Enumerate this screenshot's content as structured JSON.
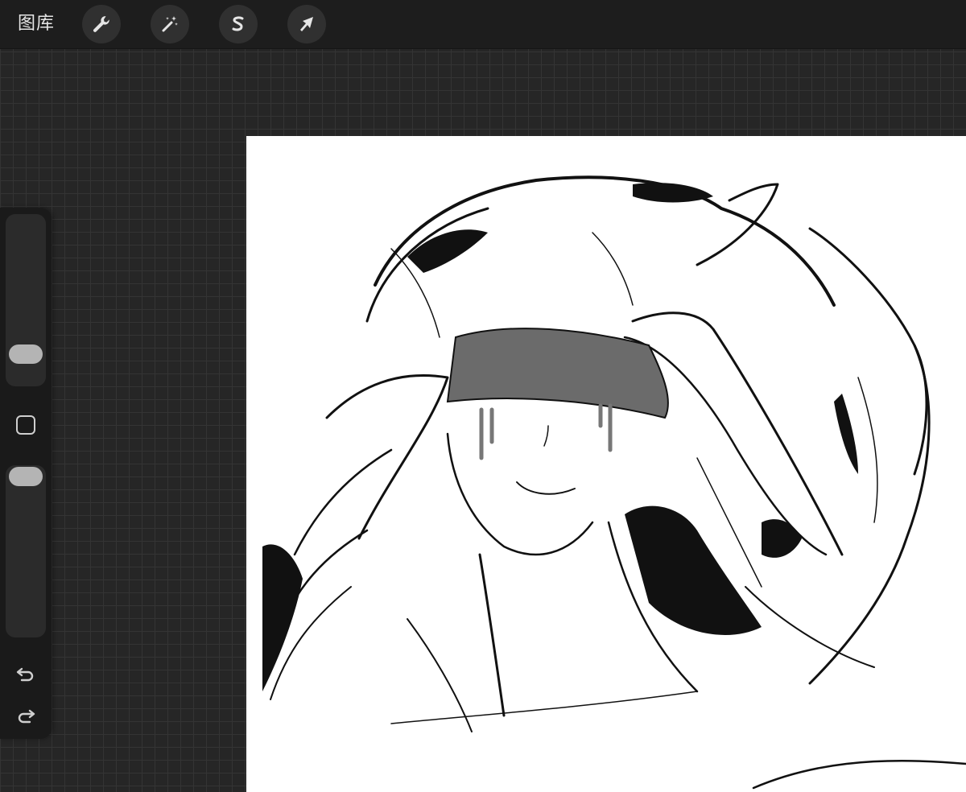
{
  "toolbar": {
    "gallery_label": "图库",
    "tools": [
      {
        "name": "actions",
        "icon": "wrench-icon"
      },
      {
        "name": "adjustments",
        "icon": "magic-wand-icon"
      },
      {
        "name": "selection",
        "icon": "selection-s-icon"
      },
      {
        "name": "transform",
        "icon": "arrow-cursor-icon"
      }
    ]
  },
  "sidebar": {
    "brush_size_level": 0.82,
    "brush_opacity_level": 1.0,
    "modify_icon": "square-icon",
    "undo_icon": "undo-icon",
    "redo_icon": "redo-icon"
  },
  "theme": {
    "background": "#262626",
    "grid_line": "#343434",
    "toolbar": "#1d1d1d",
    "button": "#303030",
    "icon": "#e6e6e6",
    "canvas": "#ffffff"
  }
}
